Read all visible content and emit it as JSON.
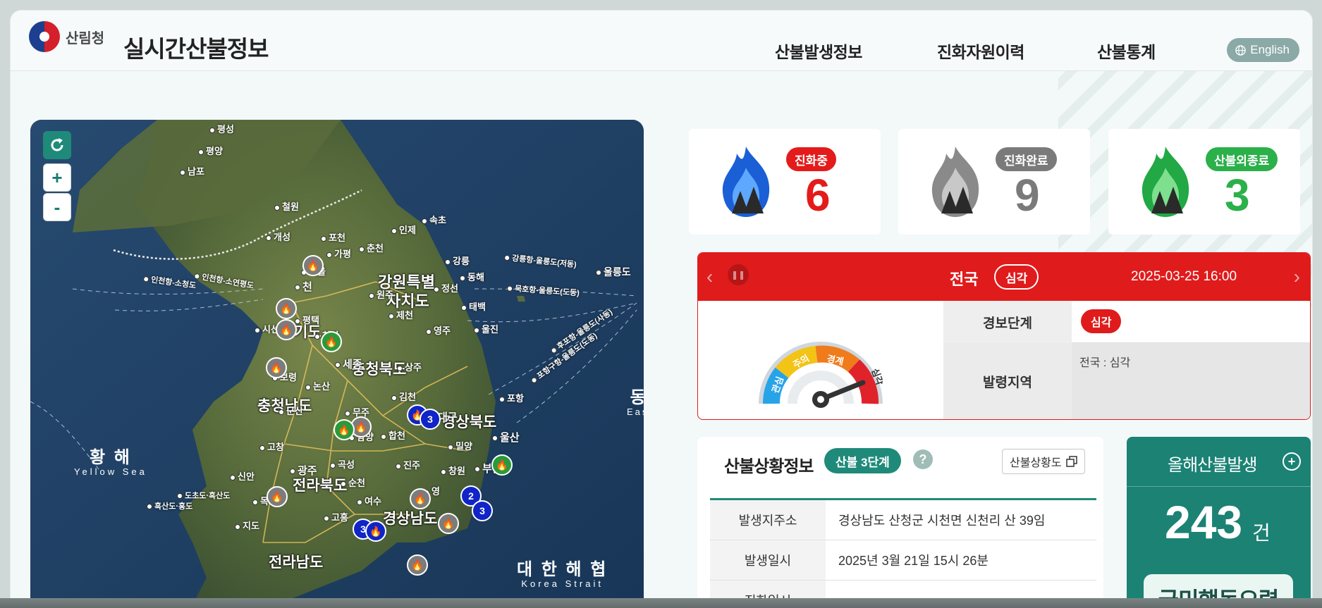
{
  "header": {
    "org": "산림청",
    "title": "실시간산불정보",
    "nav": [
      "산불발생정보",
      "진화자원이력",
      "산불통계"
    ],
    "lang_label": "English"
  },
  "map": {
    "zoom_in": "+",
    "zoom_out": "-",
    "regions": [
      "강원특별자치도",
      "충청북도",
      "충청남도",
      "전라북도",
      "전라남도",
      "경상남도",
      "경상북도",
      "기도"
    ],
    "cities": [
      "평성",
      "평양",
      "남포",
      "철원",
      "개성",
      "포천",
      "가평",
      "춘천",
      "인제",
      "속초",
      "서울",
      "천",
      "원주",
      "강릉",
      "동해",
      "정선",
      "태백",
      "제천",
      "영주",
      "울진",
      "평택",
      "천안",
      "세종",
      "보령",
      "논산",
      "상주",
      "김천",
      "포항",
      "군산",
      "무주",
      "대구",
      "고창",
      "함양",
      "합천",
      "밀양",
      "울산",
      "광주",
      "곡성",
      "진주",
      "창원",
      "부산",
      "신안",
      "순천",
      "영",
      "목포",
      "여수",
      "고흥",
      "지도",
      "흑산도·홍도",
      "도초도·흑산도",
      "울릉도",
      "시선"
    ],
    "seas": {
      "yellow_ko": "황 해",
      "yellow_en": "Yellow Sea",
      "strait_ko": "대 한 해 협",
      "strait_en": "Korea Strait",
      "east_ko": "동",
      "east_en": "Eas"
    },
    "routes": [
      "인천항-소청도",
      "인천항-소연평도",
      "강릉항-울릉도(저동)",
      "묵호항-울릉도(도동)",
      "후포항-울릉도(사동)",
      "포항구항-울릉도(도동)"
    ],
    "marker_numbers": [
      "3",
      "2",
      "3",
      "3"
    ]
  },
  "stats": [
    {
      "label": "진화중",
      "value": "6",
      "color": "#e41b1b",
      "icon": "blue-fire-icon"
    },
    {
      "label": "진화완료",
      "value": "9",
      "color": "#7a7a7a",
      "icon": "grey-fire-icon"
    },
    {
      "label": "산불외종료",
      "value": "3",
      "color": "#2bb04a",
      "icon": "green-fire-icon"
    }
  ],
  "alert": {
    "region": "전국",
    "level": "심각",
    "datetime": "2025-03-25 16:00",
    "gauge_labels": [
      "관심",
      "주의",
      "경계",
      "심각"
    ],
    "rows": {
      "stage_label": "경보단계",
      "stage_value": "심각",
      "area_label": "발령지역",
      "area_value": "전국 : 심각"
    }
  },
  "situation": {
    "title": "산불상황정보",
    "stage": "산불 3단계",
    "help": "?",
    "map_button": "산불상황도",
    "rows": [
      {
        "label": "발생지주소",
        "value": "경상남도 산청군 시천면 신천리 산 39임"
      },
      {
        "label": "발생일시",
        "value": "2025년 3월 21일 15시 26분"
      },
      {
        "label": "진화일시",
        "value": "-"
      }
    ]
  },
  "yearly": {
    "title": "올해산불발생",
    "count": "243",
    "unit": "건",
    "action_button": "국민행동요령"
  }
}
